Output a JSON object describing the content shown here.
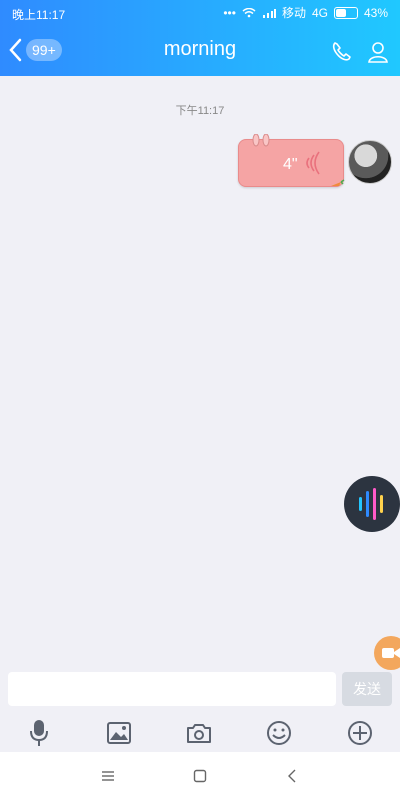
{
  "status_bar": {
    "time": "晚上11:17",
    "carrier": "移动",
    "network": "4G",
    "battery": "43%"
  },
  "header": {
    "unread_badge": "99+",
    "title": "morning"
  },
  "chat": {
    "timestamp": "下午11:17",
    "voice_message": {
      "duration": "4\""
    }
  },
  "composer": {
    "input_value": "",
    "send_label": "发送"
  },
  "icons": {
    "back": "back-arrow-icon",
    "phone": "phone-icon",
    "profile": "profile-icon",
    "voice_input": "microphone-icon",
    "image": "image-icon",
    "camera": "camera-icon",
    "emoji": "emoji-icon",
    "plus": "plus-icon",
    "nav_menu": "menu-icon",
    "nav_home": "home-icon",
    "nav_back": "nav-back-icon"
  },
  "colors": {
    "header_gradient_start": "#2f8bff",
    "header_gradient_end": "#20c8ff",
    "voice_bubble": "#f5a4a4",
    "floating_voice_bg": "#2c3440",
    "floating_video_bg": "#f3a75d",
    "send_button_disabled": "#d7dbe2"
  }
}
